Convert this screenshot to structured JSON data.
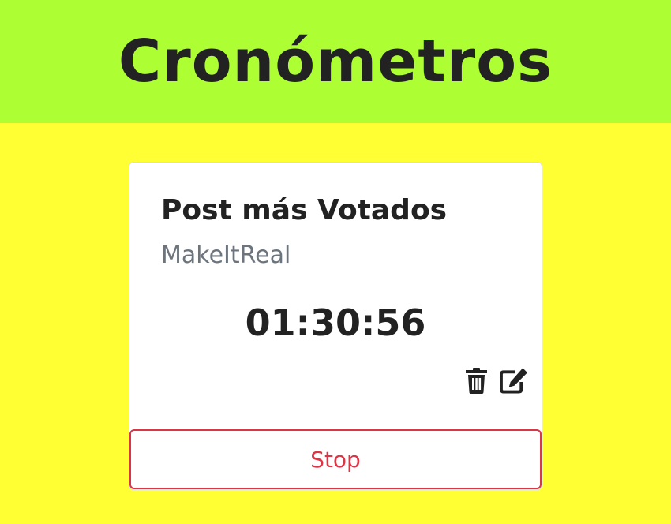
{
  "header": {
    "title": "Cronómetros",
    "background_color": "#adff33"
  },
  "page": {
    "background_color": "#ffff33"
  },
  "timer_card": {
    "title": "Post más Votados",
    "project": "MakeItReal",
    "elapsed": "01:30:56",
    "icons": {
      "delete": "trash-icon",
      "edit": "edit-icon"
    },
    "action_label": "Stop",
    "action_color": "#dc3545"
  }
}
